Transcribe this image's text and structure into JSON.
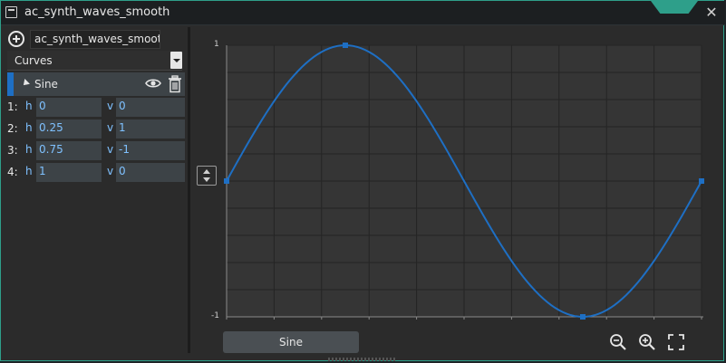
{
  "window": {
    "title": "ac_synth_waves_smooth",
    "accent": "#2e9f8a"
  },
  "panel": {
    "name_value": "ac_synth_waves_smooth",
    "dropdown_value": "Curves",
    "curve": {
      "name": "Sine",
      "color": "#1e6fc4"
    },
    "h_label": "h",
    "v_label": "v",
    "points": [
      {
        "index": "1:",
        "h": "0",
        "v": "0"
      },
      {
        "index": "2:",
        "h": "0.25",
        "v": "1"
      },
      {
        "index": "3:",
        "h": "0.75",
        "v": "-1"
      },
      {
        "index": "4:",
        "h": "1",
        "v": "0"
      }
    ]
  },
  "graph": {
    "y_max_label": "1",
    "y_min_label": "-1",
    "legend_label": "Sine"
  },
  "chart_data": {
    "type": "line",
    "title": "",
    "xlabel": "",
    "ylabel": "",
    "xlim": [
      0,
      1
    ],
    "ylim": [
      -1,
      1
    ],
    "grid": true,
    "series": [
      {
        "name": "Sine",
        "color": "#1e6fc4",
        "points": [
          {
            "x": 0,
            "y": 0
          },
          {
            "x": 0.25,
            "y": 1
          },
          {
            "x": 0.75,
            "y": -1
          },
          {
            "x": 1,
            "y": 0
          }
        ]
      }
    ]
  },
  "icons": {
    "add": "add-circle-icon",
    "eye": "eye-icon",
    "trash": "trash-icon",
    "zoom_out": "zoom-out-icon",
    "zoom_in": "zoom-in-icon",
    "fit": "fit-view-icon",
    "close": "close-icon",
    "window": "window-icon",
    "toggle": "expand-vertical-icon"
  }
}
